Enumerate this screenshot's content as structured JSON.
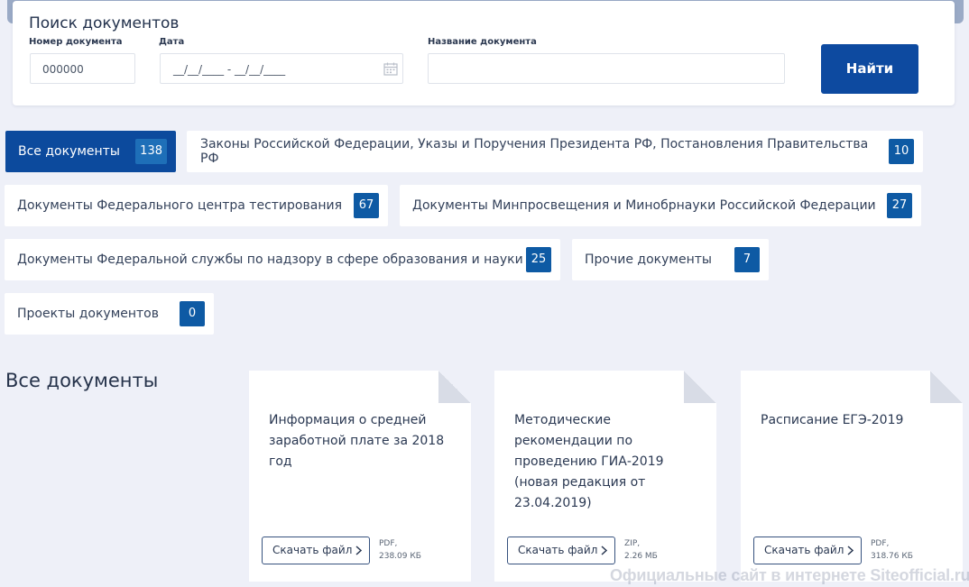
{
  "search": {
    "title": "Поиск документов",
    "number_label": "Номер документа",
    "number_value": "000000",
    "date_label": "Дата",
    "date_value": "__/__/____ - __/__/____",
    "name_label": "Название документа",
    "name_value": "",
    "find_label": "Найти"
  },
  "categories": [
    {
      "label": "Все документы",
      "count": "138",
      "active": true
    },
    {
      "label": "Законы Российской Федерации, Указы и Поручения Президента РФ, Постановления Правительства РФ",
      "count": "10"
    },
    {
      "label": "Документы Федерального центра тестирования",
      "count": "67"
    },
    {
      "label": "Документы Минпросвещения и Минобрнауки Российской Федерации",
      "count": "27"
    },
    {
      "label": "Документы Федеральной службы по надзору в сфере образования и науки",
      "count": "25"
    },
    {
      "label": "Прочие документы",
      "count": "7"
    },
    {
      "label": "Проекты документов",
      "count": "0"
    }
  ],
  "section_title": "Все документы",
  "documents": [
    {
      "title": "Информация о средней заработной плате за 2018 год",
      "download_label": "Скачать файл",
      "file_type": "PDF,",
      "file_size": "238.09 КБ"
    },
    {
      "title": "Методические рекомендации по проведению ГИА-2019 (новая редакция от 23.04.2019)",
      "download_label": "Скачать файл",
      "file_type": "ZIP,",
      "file_size": "2.26 МБ"
    },
    {
      "title": "Расписание ЕГЭ-2019",
      "download_label": "Скачать файл",
      "file_type": "PDF,",
      "file_size": "318.76 КБ"
    }
  ],
  "watermark": "Официальные сайт в интернете Siteofficial.ru",
  "colors": {
    "primary": "#0c4a9d",
    "badge": "#0e5aa4",
    "background": "#eef0f8"
  }
}
